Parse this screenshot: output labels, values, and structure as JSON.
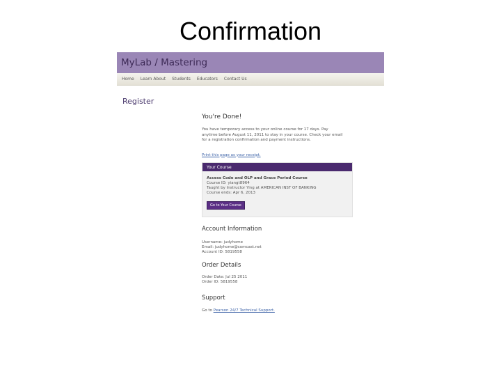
{
  "slide": {
    "title": "Confirmation"
  },
  "header": {
    "brand": "MyLab / Mastering"
  },
  "nav": {
    "items": [
      "Home",
      "Learn About",
      "Students",
      "Educators",
      "Contact Us"
    ]
  },
  "page": {
    "heading": "Register"
  },
  "done": {
    "title": "You're Done!",
    "message_1": "You have temporary access to your online course for 17 days. Pay",
    "message_2": "anytime before August 11, 2011 to stay in your course. Check your email",
    "message_3": "for a registration confirmation and payment instructions.",
    "print_link": "Print this page as your receipt."
  },
  "course": {
    "header": "Your Course",
    "name": "Access Code and OLP and Grace Period Course",
    "id_line": "Course ID: yiangt8964",
    "instructor_line": "Taught by Instructor Ying at AMERICAN INST OF BANKING",
    "ends_line": "Course ends: Apr 6, 2013",
    "button": "Go to Your Course"
  },
  "account": {
    "title": "Account Information",
    "username": "Username: judyhome",
    "email": "Email: judyhome@comcast.net",
    "account_id": "Account ID: 5819558"
  },
  "order": {
    "title": "Order Details",
    "date": "Order Date: Jul 25 2011",
    "id": "Order ID: 5819558"
  },
  "support": {
    "title": "Support",
    "text_prefix": "Go to",
    "link": "Pearson 24/7 Technical Support."
  }
}
